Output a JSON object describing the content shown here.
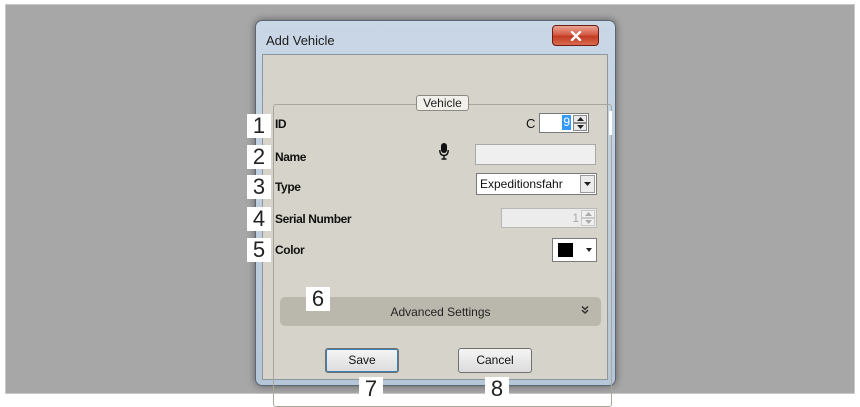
{
  "dialog": {
    "title": "Add Vehicle",
    "close_icon": "close-x-icon",
    "group_label": "Vehicle"
  },
  "callouts": [
    "1",
    "2",
    "3",
    "4",
    "5",
    "6",
    "7",
    "8"
  ],
  "form": {
    "id": {
      "label": "ID",
      "prefix": "C",
      "value": "9"
    },
    "name": {
      "label": "Name",
      "value": "",
      "mic_icon": "microphone-icon"
    },
    "type": {
      "label": "Type",
      "value": "Expeditionsfahr"
    },
    "serial_number": {
      "label": "Serial Number",
      "value": "1",
      "disabled": true
    },
    "color": {
      "label": "Color",
      "value": "#000000"
    }
  },
  "advanced": {
    "label": "Advanced Settings",
    "icon": "double-chevron-down-icon"
  },
  "buttons": {
    "save": "Save",
    "cancel": "Cancel"
  },
  "colors": {
    "title_bar": "#c9d7e6",
    "close_button": "#c94a31",
    "client_background": "#d6d4ca",
    "selection": "#3399ff"
  }
}
